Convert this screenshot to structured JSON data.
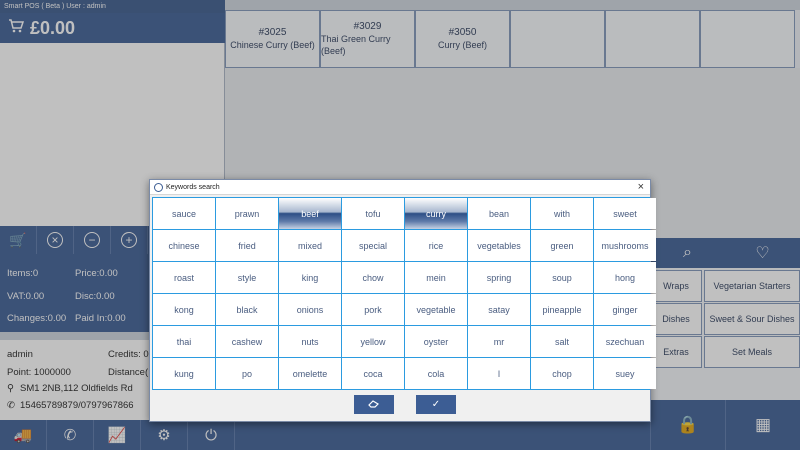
{
  "window": {
    "title": "Smart POS ( Beta )  User : admin"
  },
  "cart": {
    "total": "£0.00"
  },
  "products": [
    {
      "code": "#3025",
      "name": "Chinese Curry (Beef)"
    },
    {
      "code": "#3029",
      "name": "Thai Green Curry (Beef)"
    },
    {
      "code": "#3050",
      "name": "Curry (Beef)"
    }
  ],
  "totals": {
    "items": "Items:0",
    "price": "Price:0.00",
    "vat": "VAT:0.00",
    "disc": "Disc:0.00",
    "changes": "Changes:0.00",
    "paid_in": "Paid In:0.00"
  },
  "customer": {
    "user": "admin",
    "credits": "Credits: 0",
    "point": "Point: 1000000",
    "distance": "Distance(",
    "address": "SM1 2NB,112 Oldfields Rd",
    "phone": "15465789879/0797967866"
  },
  "categories": [
    "Wraps",
    "Vegetarian Starters",
    "Dishes",
    "Sweet & Sour Dishes",
    "Extras",
    "Set Meals"
  ],
  "dialog": {
    "title": "Keywords search",
    "close": "×",
    "keywords": [
      "sauce",
      "prawn",
      "beef",
      "tofu",
      "curry",
      "bean",
      "with",
      "sweet",
      "chinese",
      "fried",
      "mixed",
      "special",
      "rice",
      "vegetables",
      "green",
      "mushrooms",
      "roast",
      "style",
      "king",
      "chow",
      "mein",
      "spring",
      "soup",
      "hong",
      "kong",
      "black",
      "onions",
      "pork",
      "vegetable",
      "satay",
      "pineapple",
      "ginger",
      "thai",
      "cashew",
      "nuts",
      "yellow",
      "oyster",
      "mr",
      "salt",
      "szechuan",
      "kung",
      "po",
      "omelette",
      "coca",
      "cola",
      "l",
      "chop",
      "suey"
    ],
    "selected": [
      "beef",
      "curry"
    ],
    "clear_icon": "eraser-icon",
    "confirm_icon": "check-icon"
  },
  "colors": {
    "accent": "#3c5d94",
    "grid_line": "#2b9be0",
    "keyword_text": "#4a5d80"
  }
}
